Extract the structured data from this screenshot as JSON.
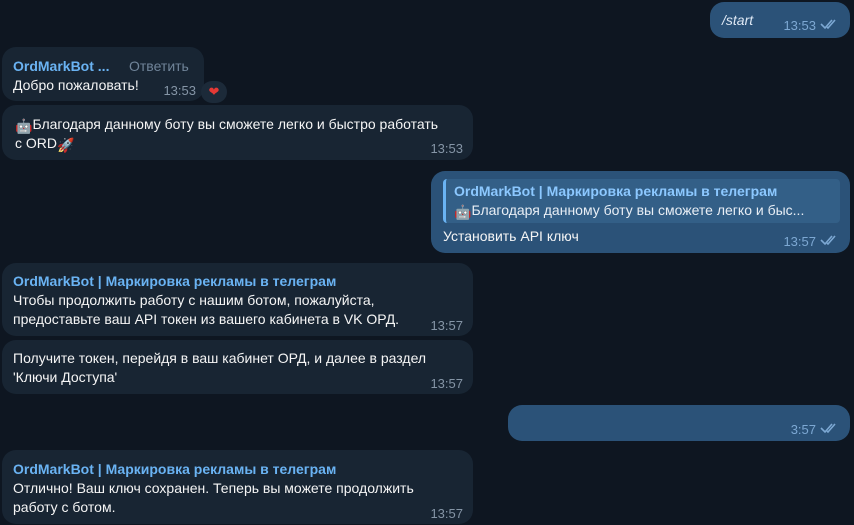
{
  "messages": {
    "m1": {
      "text": "/start",
      "time": "13:53"
    },
    "m2": {
      "sender": "OrdMarkBot ...",
      "reply_label": "Ответить",
      "text": "Добро пожаловать!",
      "time": "13:53",
      "reaction": "❤"
    },
    "m3": {
      "emoji": "🤖",
      "text_line1": "Благодаря данному боту вы сможете легко и быстро работать",
      "text_line2": "с ORD",
      "emoji_end": "🚀",
      "time": "13:53"
    },
    "m4": {
      "quote_title": "OrdMarkBot | Маркировка рекламы в телеграм",
      "quote_emoji": "🤖",
      "quote_text": "Благодаря данному боту вы сможете легко и быс...",
      "text": "Установить API ключ",
      "time": "13:57"
    },
    "m5": {
      "sender": "OrdMarkBot | Маркировка рекламы в телеграм",
      "text_line1": "Чтобы продолжить работу с нашим ботом, пожалуйста,",
      "text_line2": "предоставьте ваш API токен из вашего кабинета в VK ОРД.",
      "time": "13:57"
    },
    "m6": {
      "text_line1": "Получите токен, перейдя в ваш кабинет ОРД, и далее в раздел",
      "text_line2": "'Ключи Доступа'",
      "time": "13:57"
    },
    "m7": {
      "time": "3:57"
    },
    "m8": {
      "sender": "OrdMarkBot | Маркировка рекламы в телеграм",
      "text_line1": "Отлично! Ваш ключ сохранен. Теперь вы можете продолжить",
      "text_line2": "работу с ботом.",
      "time": "13:57"
    }
  },
  "colors": {
    "background": "#0e1621",
    "incoming": "#182533",
    "outgoing": "#2b5278",
    "sender": "#6ab3f3"
  }
}
